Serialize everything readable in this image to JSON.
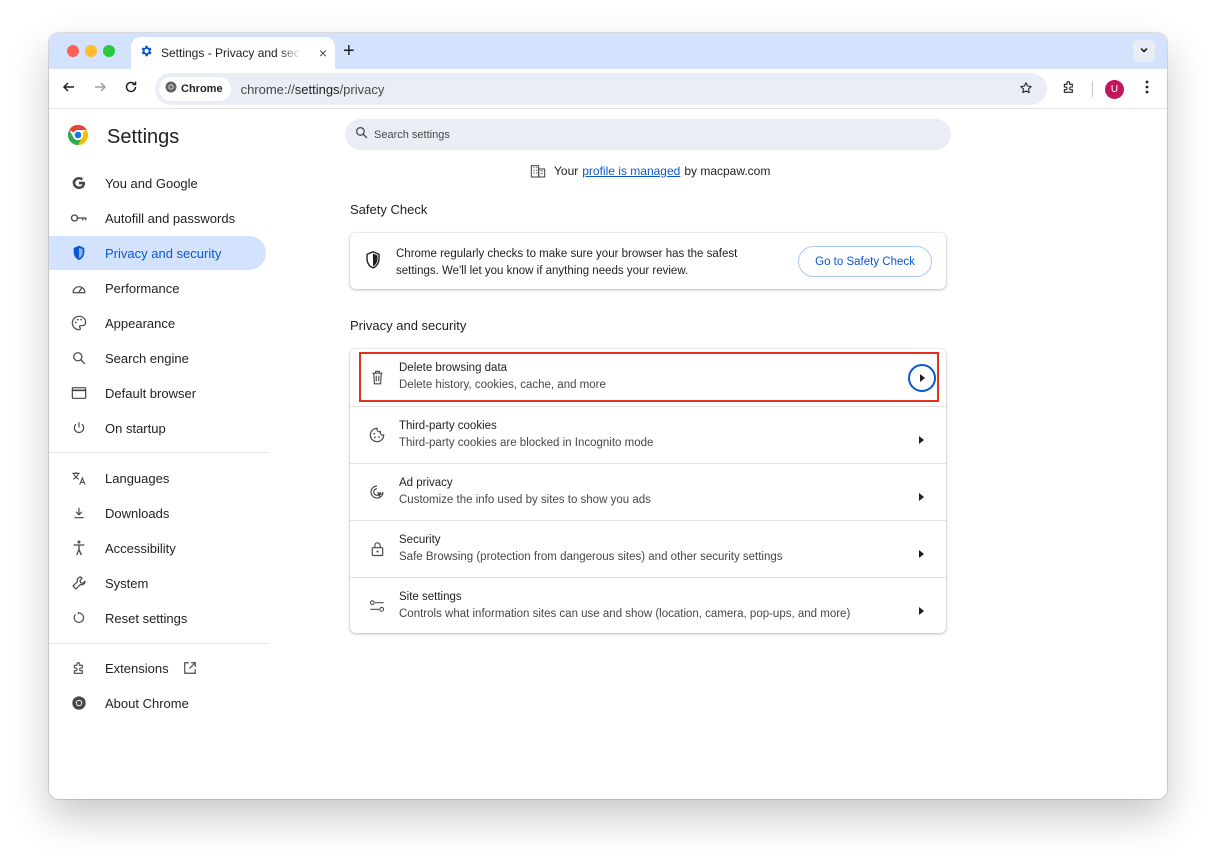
{
  "window": {
    "tab_title": "Settings - Privacy and security",
    "new_tab": "+",
    "close": "×"
  },
  "omnibox": {
    "chip_label": "Chrome",
    "url_prefix": "chrome://",
    "url_host": "settings",
    "url_path": "/privacy"
  },
  "profile": {
    "avatar_letter": "U",
    "avatar_color": "#c2185b"
  },
  "sidebar": {
    "title": "Settings",
    "items": [
      {
        "label": "You and Google",
        "icon": "google-g-icon"
      },
      {
        "label": "Autofill and passwords",
        "icon": "key-icon"
      },
      {
        "label": "Privacy and security",
        "icon": "shield-icon",
        "active": true
      },
      {
        "label": "Performance",
        "icon": "speedometer-icon"
      },
      {
        "label": "Appearance",
        "icon": "palette-icon"
      },
      {
        "label": "Search engine",
        "icon": "search-icon"
      },
      {
        "label": "Default browser",
        "icon": "browser-window-icon"
      },
      {
        "label": "On startup",
        "icon": "power-icon"
      },
      {
        "label": "Languages",
        "icon": "translate-icon"
      },
      {
        "label": "Downloads",
        "icon": "download-icon"
      },
      {
        "label": "Accessibility",
        "icon": "accessibility-icon"
      },
      {
        "label": "System",
        "icon": "wrench-icon"
      },
      {
        "label": "Reset settings",
        "icon": "reset-icon"
      },
      {
        "label": "Extensions",
        "icon": "puzzle-icon"
      },
      {
        "label": "About Chrome",
        "icon": "chrome-icon"
      }
    ]
  },
  "search": {
    "placeholder": "Search settings"
  },
  "managed": {
    "prefix": "Your",
    "link": "profile is managed",
    "suffix": "by macpaw.com"
  },
  "safety_check": {
    "title": "Safety Check",
    "text": "Chrome regularly checks to make sure your browser has the safest settings. We'll let you know if anything needs your review.",
    "button": "Go to Safety Check"
  },
  "privacy": {
    "title": "Privacy and security",
    "rows": [
      {
        "label": "Delete browsing data",
        "sub": "Delete history, cookies, cache, and more",
        "icon": "trash-icon"
      },
      {
        "label": "Third-party cookies",
        "sub": "Third-party cookies are blocked in Incognito mode",
        "icon": "cookie-icon"
      },
      {
        "label": "Ad privacy",
        "sub": "Customize the info used by sites to show you ads",
        "icon": "ad-privacy-icon"
      },
      {
        "label": "Security",
        "sub": "Safe Browsing (protection from dangerous sites) and other security settings",
        "icon": "lock-icon"
      },
      {
        "label": "Site settings",
        "sub": "Controls what information sites can use and show (location, camera, pop-ups, and more)",
        "icon": "sliders-icon"
      }
    ]
  },
  "colors": {
    "accent": "#0b57d0",
    "active_bg": "#d3e3fd",
    "highlight": "#e3311c"
  }
}
